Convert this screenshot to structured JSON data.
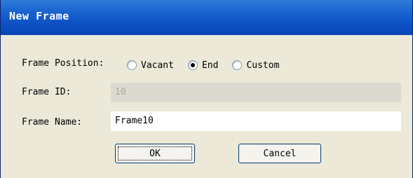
{
  "window": {
    "title": "New Frame"
  },
  "form": {
    "position_label": "Frame Position:",
    "position_options": [
      {
        "label": "Vacant",
        "checked": false
      },
      {
        "label": "End",
        "checked": true
      },
      {
        "label": "Custom",
        "checked": false
      }
    ],
    "id_label": "Frame ID:",
    "id_value": "10",
    "name_label": "Frame Name:",
    "name_value": "Frame10"
  },
  "buttons": {
    "ok_label": "OK",
    "cancel_label": "Cancel"
  },
  "colors": {
    "titlebar": "#0b50c4",
    "dialog_bg": "#ece9d8"
  }
}
